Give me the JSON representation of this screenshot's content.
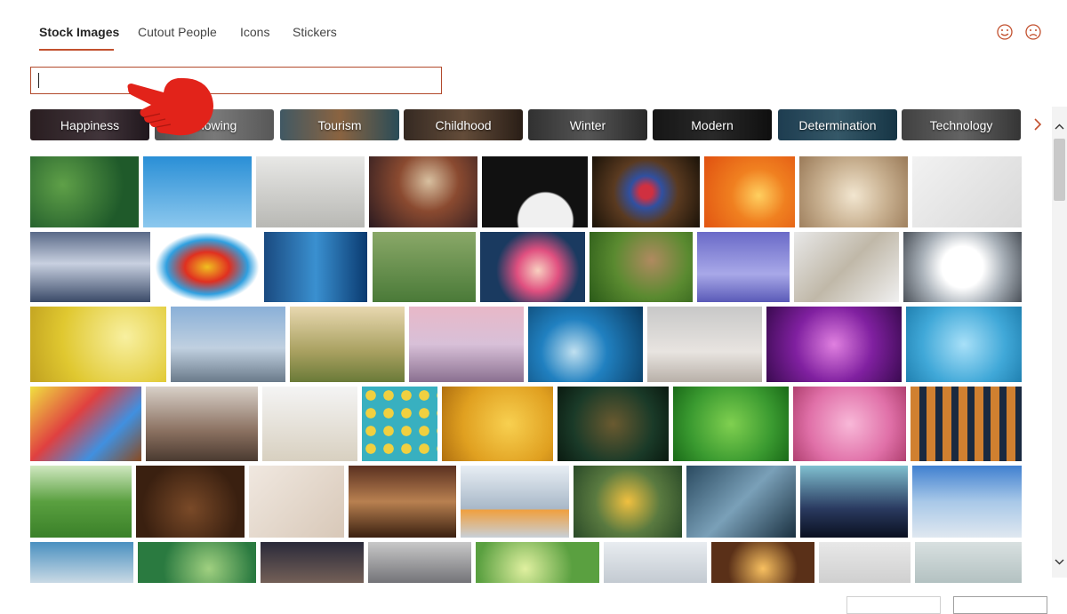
{
  "tabs": [
    {
      "label": "Stock Images",
      "active": true
    },
    {
      "label": "Cutout People",
      "active": false
    },
    {
      "label": "Icons",
      "active": false
    },
    {
      "label": "Stickers",
      "active": false
    }
  ],
  "feedback": {
    "happy_icon": "smile-icon",
    "sad_icon": "frown-icon",
    "color": "#c2502e"
  },
  "search": {
    "value": "",
    "placeholder": "",
    "border_color": "#b24a2c"
  },
  "pointer_icon": "hand-pointer-icon",
  "categories": [
    {
      "label": "Happiness"
    },
    {
      "label": "Glowing"
    },
    {
      "label": "Tourism"
    },
    {
      "label": "Childhood"
    },
    {
      "label": "Winter"
    },
    {
      "label": "Modern"
    },
    {
      "label": "Determination"
    },
    {
      "label": "Technology"
    }
  ],
  "categories_next_icon": "chevron-right-icon",
  "scrollbar": {
    "up_icon": "chevron-up-icon",
    "down_icon": "chevron-down-icon"
  },
  "image_subjects": [
    [
      "green leaves",
      "birds on wire under blue sky",
      "white kitchen",
      "crystal ball in hand",
      "white bird on dark",
      "mandrill face",
      "nautilus shell orange",
      "dandelion seed head",
      "desk with tools"
    ],
    [
      "icebergs at dusk",
      "colorful ink splash",
      "glass skyscrapers",
      "baseball player",
      "pink plumeria flowers",
      "cat in grass",
      "sailboat on lavender sea",
      "office team at whiteboard",
      "stopwatch"
    ],
    [
      "lemon slice",
      "city skyline",
      "person in field",
      "oil rig silhouette",
      "microscope",
      "horses on beach",
      "purple sparkle bokeh",
      "blue water bubbles"
    ],
    [
      "colored pencils",
      "students studying",
      "cotton swabs in jars",
      "yellow dots on teal",
      "bee on honeycomb",
      "tiger in forest",
      "green pea pods",
      "pink flowers",
      "building facade"
    ],
    [
      "golf glove on grass",
      "coffee beans",
      "paper hearts",
      "hand stamping",
      "robot factory",
      "woman in yellow",
      "agave leaf",
      "concert crowd",
      "golden gate bridge"
    ],
    [
      "handshake",
      "green nature",
      "business handshake",
      "person with laptop",
      "green bokeh",
      "hawk flying",
      "glass with lights",
      "grey flowers",
      "pale seascape"
    ]
  ]
}
